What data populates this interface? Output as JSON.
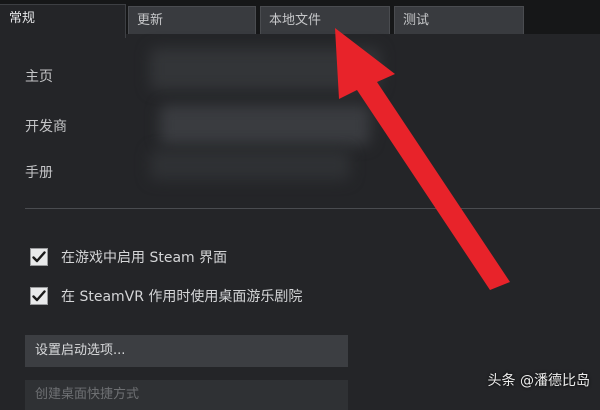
{
  "tabs": [
    {
      "label": "常规",
      "active": true
    },
    {
      "label": "更新",
      "active": false
    },
    {
      "label": "本地文件",
      "active": false
    },
    {
      "label": "测试",
      "active": false
    }
  ],
  "info": {
    "home_label": "主页",
    "developer_label": "开发商",
    "manual_label": "手册"
  },
  "checkboxes": [
    {
      "label": "在游戏中启用 Steam 界面",
      "checked": true
    },
    {
      "label": "在 SteamVR 作用时使用桌面游乐剧院",
      "checked": true
    }
  ],
  "buttons": {
    "launch_options": "设置启动选项...",
    "desktop_shortcut": "创建桌面快捷方式"
  },
  "annotation": {
    "arrow_color": "#e8232a"
  },
  "watermark": "头条 @潘德比岛"
}
